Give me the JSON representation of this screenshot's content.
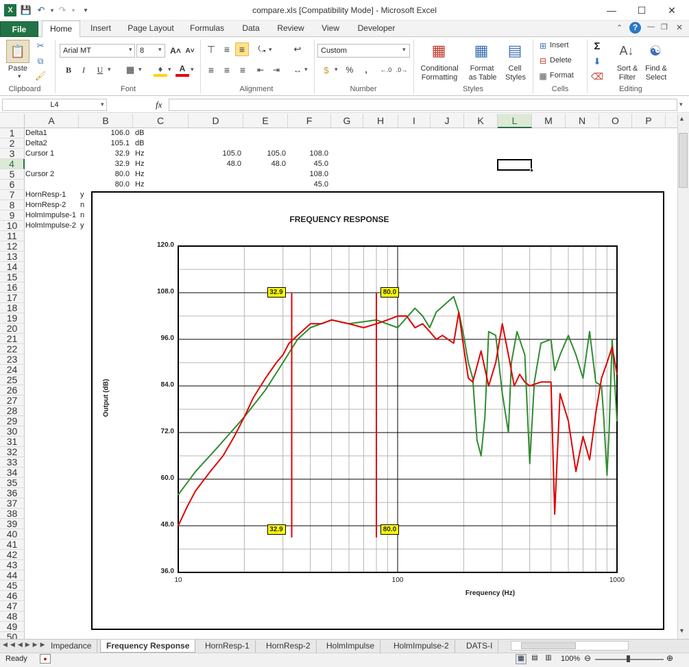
{
  "window": {
    "title": "compare.xls  [Compatibility Mode]  -  Microsoft Excel"
  },
  "ribbon_tabs": [
    "File",
    "Home",
    "Insert",
    "Page Layout",
    "Formulas",
    "Data",
    "Review",
    "View",
    "Developer"
  ],
  "ribbon": {
    "clipboard": {
      "paste": "Paste",
      "label": "Clipboard"
    },
    "font": {
      "name": "Arial MT",
      "size": "8",
      "label": "Font",
      "bold": "B",
      "italic": "I",
      "underline": "U"
    },
    "alignment": {
      "label": "Alignment"
    },
    "number": {
      "format": "Custom",
      "label": "Number",
      "percent": "%",
      "comma": ","
    },
    "styles": {
      "conditional": "Conditional\nFormatting",
      "conditional_l1": "Conditional",
      "conditional_l2": "Formatting",
      "table_l1": "Format",
      "table_l2": "as Table",
      "cell_l1": "Cell",
      "cell_l2": "Styles",
      "label": "Styles"
    },
    "cells": {
      "insert": "Insert",
      "delete": "Delete",
      "format": "Format",
      "label": "Cells"
    },
    "editing": {
      "sort_l1": "Sort &",
      "sort_l2": "Filter",
      "find_l1": "Find &",
      "find_l2": "Select",
      "label": "Editing"
    }
  },
  "formula_bar": {
    "name_box": "L4",
    "fx": "fx",
    "formula": ""
  },
  "columns": [
    "A",
    "B",
    "C",
    "D",
    "E",
    "F",
    "G",
    "H",
    "I",
    "J",
    "K",
    "L",
    "M",
    "N",
    "O",
    "P"
  ],
  "rows": [
    "1",
    "2",
    "3",
    "4",
    "5",
    "6",
    "7",
    "8",
    "9",
    "10",
    "11",
    "12",
    "13",
    "14",
    "15",
    "16",
    "17",
    "18",
    "19",
    "20",
    "21",
    "22",
    "23",
    "24",
    "25",
    "26",
    "27",
    "28",
    "29",
    "30",
    "31",
    "32",
    "33",
    "34",
    "35",
    "36",
    "37",
    "38",
    "39",
    "40",
    "41",
    "42",
    "43",
    "44",
    "45",
    "46",
    "47",
    "48",
    "49",
    "50"
  ],
  "cells": {
    "a1": "Delta1",
    "b1": "106.0",
    "c1": "dB",
    "a2": "Delta2",
    "b2": "105.1",
    "c2": "dB",
    "a3": "Cursor 1",
    "b3": "32.9",
    "c3": "Hz",
    "d3": "105.0",
    "e3": "105.0",
    "f3": "108.0",
    "b4": "32.9",
    "c4": "Hz",
    "d4": "48.0",
    "e4": "48.0",
    "f4": "45.0",
    "a5": "Cursor 2",
    "b5": "80.0",
    "c5": "Hz",
    "f5": "108.0",
    "b6": "80.0",
    "c6": "Hz",
    "f6": "45.0",
    "a7": "HornResp-1",
    "b7": "y",
    "a8": "HornResp-2",
    "b8": "n",
    "a9": "HolmImpulse-1",
    "b9": "n",
    "a10": "HolmImpulse-2",
    "b10": "y"
  },
  "chart_data": {
    "type": "line",
    "title": "FREQUENCY RESPONSE",
    "xlabel": "Frequency (Hz)",
    "ylabel": "Output (dB)",
    "x_scale": "log",
    "xlim": [
      10,
      1000
    ],
    "ylim": [
      36,
      120
    ],
    "y_ticks": [
      "120.0",
      "108.0",
      "96.0",
      "84.0",
      "72.0",
      "60.0",
      "48.0",
      "36.0"
    ],
    "x_ticks": [
      "10",
      "100",
      "1000"
    ],
    "grid": true,
    "cursors": [
      {
        "x": 32.9,
        "label": "32.9"
      },
      {
        "x": 80.0,
        "label": "80.0"
      }
    ],
    "series": [
      {
        "color": "#2e8b2e",
        "x": [
          10,
          12,
          15,
          20,
          25,
          30,
          35,
          40,
          50,
          60,
          80,
          100,
          120,
          130,
          140,
          150,
          180,
          190,
          200,
          210,
          220,
          230,
          240,
          250,
          260,
          280,
          300,
          320,
          330,
          350,
          380,
          400,
          420,
          450,
          500,
          520,
          550,
          600,
          650,
          700,
          750,
          800,
          850,
          870,
          900,
          920,
          950,
          1000
        ],
        "y": [
          56,
          62,
          68,
          76,
          83,
          90,
          96,
          99,
          101,
          100,
          101,
          99,
          104,
          102,
          99,
          103,
          107,
          103,
          97,
          90,
          86,
          70,
          66,
          76,
          98,
          97,
          82,
          72,
          90,
          98,
          92,
          64,
          85,
          95,
          96,
          88,
          92,
          97,
          92,
          86,
          98,
          85,
          84,
          76,
          61,
          72,
          96,
          75
        ]
      },
      {
        "color": "#e00000",
        "x": [
          10,
          11,
          12,
          14,
          16,
          18,
          20,
          22,
          25,
          28,
          30,
          32,
          35,
          40,
          45,
          50,
          60,
          70,
          80,
          90,
          100,
          110,
          120,
          130,
          140,
          150,
          160,
          180,
          190,
          200,
          210,
          220,
          240,
          260,
          280,
          300,
          320,
          340,
          360,
          380,
          400,
          450,
          500,
          520,
          550,
          600,
          650,
          700,
          750,
          800,
          850,
          900,
          950,
          1000
        ],
        "y": [
          48,
          53,
          57,
          62,
          66,
          71,
          76,
          81,
          86,
          90,
          92,
          95,
          97,
          100,
          100,
          101,
          100,
          99,
          100,
          101,
          102,
          102,
          99,
          100,
          98,
          96,
          97,
          95,
          103,
          94,
          86,
          85,
          93,
          84,
          90,
          100,
          92,
          84,
          87,
          85,
          84,
          85,
          85,
          51,
          82,
          75,
          62,
          71,
          65,
          77,
          86,
          90,
          94,
          87
        ]
      }
    ]
  },
  "sheet_tabs": [
    "Impedance",
    "Frequency Response",
    "HornResp-1",
    "HornResp-2",
    "HolmImpulse",
    "HolmImpulse-2",
    "DATS-I"
  ],
  "active_sheet": "Frequency Response",
  "status": {
    "ready": "Ready",
    "zoom": "100%"
  }
}
